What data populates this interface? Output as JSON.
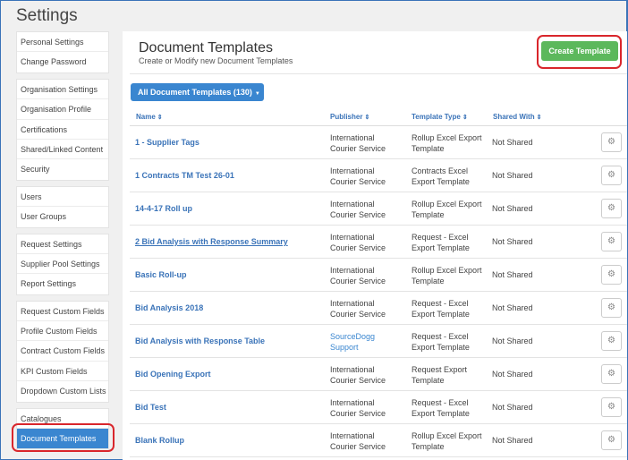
{
  "page": {
    "title": "Settings"
  },
  "sidebar": {
    "groups": [
      [
        "Personal Settings",
        "Change Password"
      ],
      [
        "Organisation Settings",
        "Organisation Profile",
        "Certifications",
        "Shared/Linked Content",
        "Security"
      ],
      [
        "Users",
        "User Groups"
      ],
      [
        "Request Settings",
        "Supplier Pool Settings",
        "Report Settings"
      ],
      [
        "Request Custom Fields",
        "Profile Custom Fields",
        "Contract Custom Fields",
        "KPI Custom Fields",
        "Dropdown Custom Lists"
      ],
      [
        "Catalogues",
        "Document Templates"
      ]
    ],
    "active": "Document Templates"
  },
  "main": {
    "title": "Document Templates",
    "subtitle": "Create or Modify new Document Templates",
    "create_button": "Create Template",
    "filter_button": "All Document Templates (130)",
    "columns": {
      "name": "Name",
      "publisher": "Publisher",
      "type": "Template Type",
      "shared": "Shared With"
    },
    "rows": [
      {
        "name": "1 - Supplier Tags",
        "publisher": [
          "International",
          "Courier Service"
        ],
        "publisher_link": false,
        "type": [
          "Rollup Excel Export",
          "Template"
        ],
        "shared": "Not Shared",
        "underline": false
      },
      {
        "name": "1 Contracts TM Test 26-01",
        "publisher": [
          "International",
          "Courier Service"
        ],
        "publisher_link": false,
        "type": [
          "Contracts Excel",
          "Export Template"
        ],
        "shared": "Not Shared",
        "underline": false
      },
      {
        "name": "14-4-17 Roll up",
        "publisher": [
          "International",
          "Courier Service"
        ],
        "publisher_link": false,
        "type": [
          "Rollup Excel Export",
          "Template"
        ],
        "shared": "Not Shared",
        "underline": false
      },
      {
        "name": "2 Bid Analysis with Response Summary",
        "publisher": [
          "International",
          "Courier Service"
        ],
        "publisher_link": false,
        "type": [
          "Request - Excel",
          "Export Template"
        ],
        "shared": "Not Shared",
        "underline": true
      },
      {
        "name": "Basic Roll-up",
        "publisher": [
          "International",
          "Courier Service"
        ],
        "publisher_link": false,
        "type": [
          "Rollup Excel Export",
          "Template"
        ],
        "shared": "Not Shared",
        "underline": false
      },
      {
        "name": "Bid Analysis 2018",
        "publisher": [
          "International",
          "Courier Service"
        ],
        "publisher_link": false,
        "type": [
          "Request - Excel",
          "Export Template"
        ],
        "shared": "Not Shared",
        "underline": false
      },
      {
        "name": "Bid Analysis with Response Table",
        "publisher": [
          "SourceDogg",
          "Support"
        ],
        "publisher_link": true,
        "type": [
          "Request - Excel",
          "Export Template"
        ],
        "shared": "Not Shared",
        "underline": false
      },
      {
        "name": "Bid Opening Export",
        "publisher": [
          "International",
          "Courier Service"
        ],
        "publisher_link": false,
        "type": [
          "Request Export",
          "Template"
        ],
        "shared": "Not Shared",
        "underline": false
      },
      {
        "name": "Bid Test",
        "publisher": [
          "International",
          "Courier Service"
        ],
        "publisher_link": false,
        "type": [
          "Request - Excel",
          "Export Template"
        ],
        "shared": "Not Shared",
        "underline": false
      },
      {
        "name": "Blank Rollup",
        "publisher": [
          "International",
          "Courier Service"
        ],
        "publisher_link": false,
        "type": [
          "Rollup Excel Export",
          "Template"
        ],
        "shared": "Not Shared",
        "underline": false
      }
    ]
  },
  "icons": {
    "sort": "sort-icon",
    "caret": "caret-down-icon",
    "gear": "gear-icon"
  },
  "colors": {
    "accent": "#3a86d0",
    "create": "#5cb85c",
    "highlight": "#d9262c"
  }
}
